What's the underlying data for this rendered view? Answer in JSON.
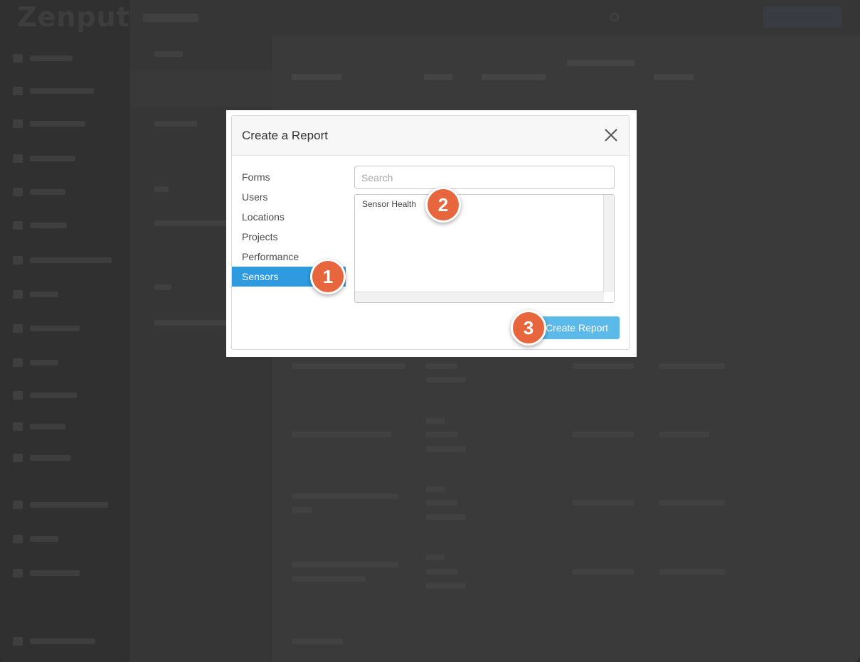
{
  "modal": {
    "title": "Create a Report",
    "categories": [
      "Forms",
      "Users",
      "Locations",
      "Projects",
      "Performance",
      "Sensors"
    ],
    "selected_category": "Sensors",
    "search_placeholder": "Search",
    "results": [
      "Sensor Health"
    ],
    "create_label": "Create Report"
  },
  "steps": [
    "1",
    "2",
    "3"
  ],
  "colors": {
    "accent": "#2e9be0",
    "button": "#5bbae9",
    "badge": "#e8663d"
  },
  "icons": {
    "close": "close-icon",
    "search": "search-icon"
  }
}
